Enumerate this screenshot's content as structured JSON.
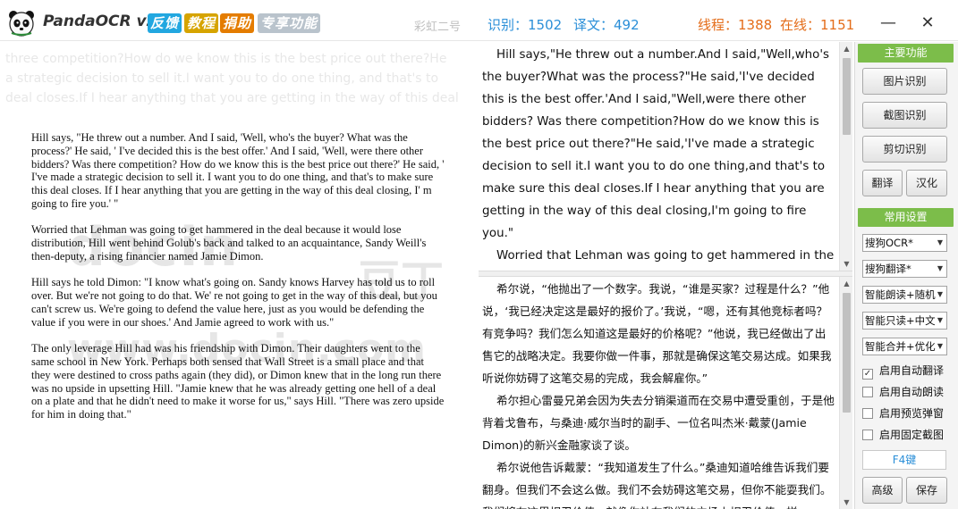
{
  "titlebar": {
    "app_name": "PandaOCR v2.6",
    "buttons": {
      "feedback": "反馈",
      "tutorial": "教程",
      "donate": "捐助",
      "vip": "专享功能"
    },
    "skin": "彩虹二号",
    "recognize_count": "识别：1502",
    "translate_count": "译文：492",
    "threads": "线程：1388",
    "online": "在线：1151",
    "minimize": "—",
    "close": "✕"
  },
  "document": {
    "ghost_lines": [
      "three competition?How do we know this is the best price out there?He",
      "a strategic decision to sell it.I want you to do one thing, and that's to",
      "deal closes.If I hear anything that you are getting in the way of this deal"
    ],
    "paragraphs": [
      "Hill says, \"He threw out a number. And I said, 'Well, who's the buyer? What was the process?' He said, ' I've decided this is the best offer.' And I said, 'Well, were there other bidders? Was there competition? How do we know this is the best price out there?' He said, ' I've made a strategic decision to sell it. I want you to do one thing, and that's to make sure this deal closes. If I hear anything that you are getting in the way of this deal closing, I' m going to fire you.' \"",
      "Worried that Lehman was going to get hammered in the deal because it would lose distribution, Hill went behind Golub's back and talked to an acquaintance, Sandy Weill's then-deputy, a rising financier named Jamie Dimon.",
      "Hill says he told Dimon: \"I know what's going on. Sandy knows Harvey has told us to roll over. But we're not going to do that. We' re not going to get in the way of this deal, but you can't screw us. We're going to defend the value here, just as you would be defending the value if you were in our shoes.' And Jamie agreed to work with us.\"",
      "The only leverage Hill had was his friendship with Dimon. Their daughters went to the same school in New York. Perhaps both sensed that Wall Street is a small place and that they were destined to cross paths again (they did), or Dimon knew that in the long run there was no upside in upsetting Hill. \"Jamie knew that he was already getting one hell of a deal on a plate and that he didn't need to make it worse for us,\" says Hill. \"There was zero upside for him in doing that.\""
    ],
    "watermark_1": "docin",
    "watermark_2": "豆丁",
    "watermark_3": "www.docin.com"
  },
  "ocr_text": {
    "paragraphs": [
      "Hill says,\"He threw out a number.And I said,\"Well,who's the buyer?What was the process?\"He said,'I've decided this is the best offer.'And I said,\"Well,were there other bidders? Was there competition?How do we know this is the best price out there?\"He said,'I've made a strategic decision to sell it.I want you to do one thing,and that's to make sure this deal closes.If I hear anything that you are getting in the way of this deal closing,I'm going to fire you.\"",
      "Worried that Lehman was going to get hammered in the deal because it would lose distribution,Hill went behind Golub's back and talked to an acquaintance,Sandy Weill's then-deputy"
    ]
  },
  "translation": {
    "paragraphs": [
      "希尔说，“他抛出了一个数字。我说，“谁是买家？过程是什么？”他说，‘我已经决定这是最好的报价了。’我说，“嗯，还有其他竞标者吗？有竞争吗？我们怎么知道这是最好的价格呢？”他说，我已经做出了出售它的战略决定。我要你做一件事，那就是确保这笔交易达成。如果我听说你妨碍了这笔交易的完成，我会解雇你。”",
      "希尔担心雷曼兄弟会因为失去分销渠道而在交易中遭受重创，于是他背着戈鲁布，与桑迪·威尔当时的副手、一位名叫杰米·戴蒙(Jamie Dimon)的新兴金融家谈了谈。",
      "希尔说他告诉戴蒙：“我知道发生了什么。”桑迪知道哈维告诉我们要翻身。但我们不会这么做。我们不会妨碍这笔交易，但你不能耍我们。我们将在这里捍卫价值，就像你站在我们的立场上捍卫价值一样。"
    ]
  },
  "sidebar": {
    "main_header": "主要功能",
    "btn_image": "图片识别",
    "btn_screenshot": "截图识别",
    "btn_clipboard": "剪切识别",
    "btn_translate": "翻译",
    "btn_localize": "汉化",
    "settings_header": "常用设置",
    "dropdowns": [
      "搜狗OCR*",
      "搜狗翻译*",
      "智能朗读+随机",
      "智能只读+中文",
      "智能合并+优化"
    ],
    "checkboxes": [
      {
        "label": "启用自动翻译",
        "checked": true
      },
      {
        "label": "启用自动朗读",
        "checked": false
      },
      {
        "label": "启用预览弹窗",
        "checked": false
      },
      {
        "label": "启用固定截图",
        "checked": false
      }
    ],
    "hotkey": "F4键",
    "btn_advanced": "高级",
    "btn_save": "保存"
  },
  "colors": {
    "accent_blue": "#2b8fd8",
    "accent_orange": "#e46d1a",
    "section_green": "#7cbd4a"
  }
}
